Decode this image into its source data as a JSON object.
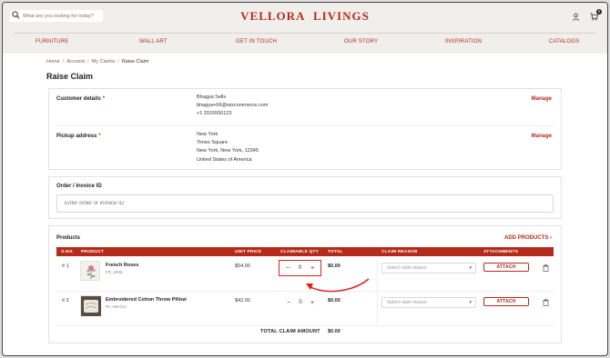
{
  "header": {
    "search_placeholder": "What are you looking for today?",
    "brand_part1": "VELLORA",
    "brand_part2": "LIVINGS",
    "cart_count": "0",
    "icons": [
      "search-icon",
      "user-icon",
      "cart-icon"
    ]
  },
  "nav": [
    "FURNITURE",
    "WALL ART",
    "GET IN TOUCH",
    "OUR STORY",
    "INSPIRATION",
    "CATALOGS"
  ],
  "breadcrumb": [
    "Home",
    "Account",
    "My Claims",
    "Raise Claim"
  ],
  "page_title": "Raise Claim",
  "customer": {
    "label": "Customer details",
    "required": "*",
    "name": "Bhagya Sells",
    "email": "bhagya+06@wizcommerce.com",
    "phone": "+1 2015550123",
    "manage": "Manage"
  },
  "pickup": {
    "label": "Pickup address",
    "required": "*",
    "line1": "New York",
    "line2": "Times Square",
    "line3": "New York, New York, 12345",
    "line4": "United States of America",
    "manage": "Manage"
  },
  "order": {
    "label": "Order / Invoice ID",
    "placeholder": "Enter order or invoice ID"
  },
  "products": {
    "label": "Products",
    "add_label": "ADD PRODUCTS ›",
    "columns": [
      "S.NO.",
      "PRODUCT",
      "UNIT PRICE",
      "CLAIMABLE QTY",
      "TOTAL",
      "CLAIM REASON",
      "ATTACHMENTS"
    ],
    "rows": [
      {
        "sno": "# 1",
        "name": "French Roses",
        "sku": "FR_2838",
        "unit_price": "$54.00",
        "qty": "0",
        "total": "$0.00",
        "reason_placeholder": "Select claim reason",
        "attach": "ATTACH"
      },
      {
        "sno": "# 2",
        "name": "Embroidered Cotton Throw Pillow",
        "sku": "PL-AW-012",
        "unit_price": "$42.00",
        "qty": "0",
        "total": "$0.00",
        "reason_placeholder": "Select claim reason",
        "attach": "ATTACH"
      }
    ],
    "total_label": "TOTAL CLAIM AMOUNT",
    "total_value": "$0.00"
  },
  "colors": {
    "brand": "#b52b1b",
    "highlight": "#e02020"
  }
}
